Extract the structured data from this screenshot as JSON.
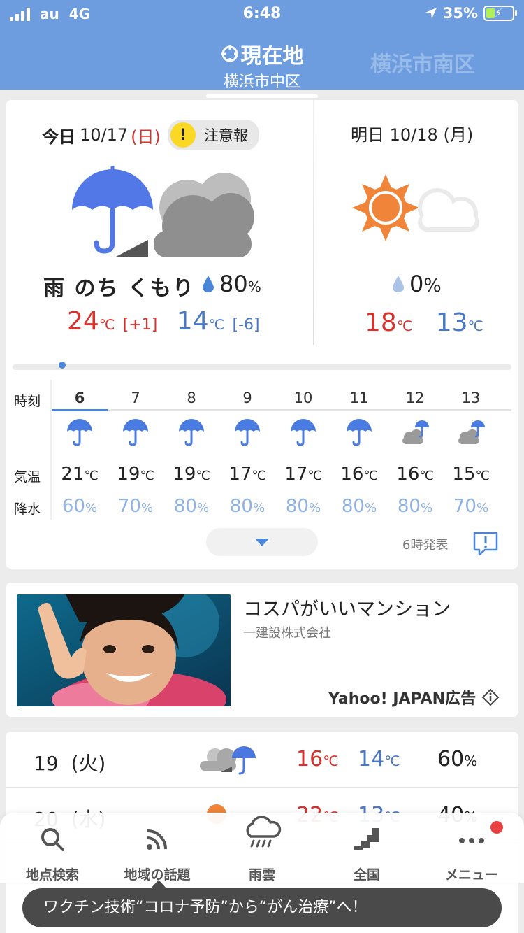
{
  "status_bar": {
    "carrier": "au",
    "network": "4G",
    "time": "6:48",
    "battery": "35%"
  },
  "header": {
    "tabs": [
      {
        "label": "現在地",
        "sub": "横浜市中区",
        "active": true
      },
      {
        "label": "横浜市南区",
        "active": false
      }
    ]
  },
  "today": {
    "label": "今日",
    "date": "10/17",
    "weekday": "(日)",
    "alert": "注意報",
    "weather": "雨 のち くもり",
    "pop": "80",
    "pop_unit": "%",
    "high": "24",
    "high_diff": "[+1]",
    "low": "14",
    "low_diff": "[-6]",
    "unit": "℃",
    "icon": "rain-then-cloudy-icon"
  },
  "tomorrow": {
    "label": "明日",
    "date": "10/18",
    "weekday": "(月)",
    "pop": "0",
    "pop_unit": "%",
    "high": "18",
    "low": "13",
    "unit": "℃",
    "icon": "sunny-then-cloudy-icon"
  },
  "hourly": {
    "labels": {
      "time": "時刻",
      "temp": "気温",
      "precip": "降水"
    },
    "unit_temp": "℃",
    "unit_pop": "%",
    "hours": [
      {
        "hour": "6",
        "icon": "umbrella",
        "temp": "21",
        "pop": "60"
      },
      {
        "hour": "7",
        "icon": "umbrella",
        "temp": "19",
        "pop": "70"
      },
      {
        "hour": "8",
        "icon": "umbrella",
        "temp": "19",
        "pop": "80"
      },
      {
        "hour": "9",
        "icon": "umbrella",
        "temp": "17",
        "pop": "80"
      },
      {
        "hour": "10",
        "icon": "umbrella",
        "temp": "17",
        "pop": "80"
      },
      {
        "hour": "11",
        "icon": "umbrella",
        "temp": "16",
        "pop": "80"
      },
      {
        "hour": "12",
        "icon": "cloud-umbrella",
        "temp": "16",
        "pop": "80"
      },
      {
        "hour": "13",
        "icon": "cloud-umbrella",
        "temp": "15",
        "pop": "70"
      }
    ],
    "published": "6時発表"
  },
  "ad": {
    "title": "コスパがいいマンション",
    "advertiser": "一建設株式会社",
    "brand": "Yahoo! JAPAN広告"
  },
  "weekly": [
    {
      "day": "19",
      "weekday": "(火)",
      "high": "16",
      "low": "14",
      "pop": "60"
    },
    {
      "day": "20",
      "weekday": "(水)",
      "high": "22",
      "low": "13",
      "pop": "40"
    }
  ],
  "nav": {
    "items": [
      {
        "label": "地点検索",
        "icon": "search-icon"
      },
      {
        "label": "地域の話題",
        "icon": "feed-icon"
      },
      {
        "label": "雨雲",
        "icon": "rain-cloud-icon"
      },
      {
        "label": "全国",
        "icon": "map-icon"
      },
      {
        "label": "メニュー",
        "icon": "more-icon"
      }
    ]
  },
  "toast": "ワクチン技術“コロナ予防”から“がん治療”へ！",
  "colors": {
    "header_bg": "#6d9cdf",
    "high_temp": "#d8322d",
    "low_temp": "#4a78c4",
    "umbrella": "#4a7be0"
  }
}
